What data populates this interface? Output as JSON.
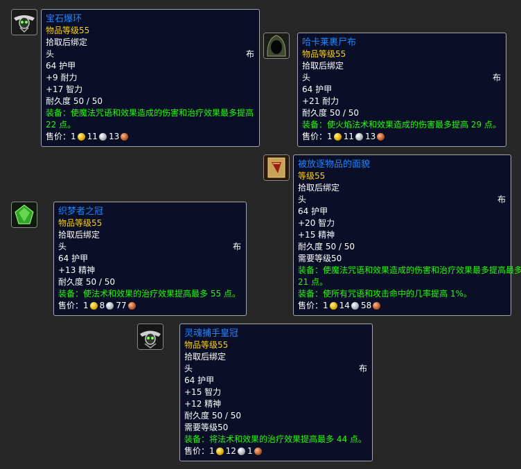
{
  "labels": {
    "bind": "拾取后绑定",
    "slot": "头",
    "type": "布",
    "equip_prefix": "装备：",
    "price_prefix": "售价："
  },
  "items": [
    {
      "name": "宝石爆环",
      "level": "物品等级55",
      "armor": "64 护甲",
      "stats": [
        "+9 耐力",
        "+17 智力"
      ],
      "durability": "耐久度 50 / 50",
      "equip": [
        "使魔法咒语和效果造成的伤害和治疗效果最多提高",
        "22 点。"
      ],
      "price": {
        "gold": "1",
        "silver": "11",
        "copper": "13"
      },
      "icon": "skull-circlet-icon"
    },
    {
      "name": "哈卡莱裹尸布",
      "level": "物品等级55",
      "armor": "64 护甲",
      "stats": [
        "+21 耐力"
      ],
      "durability": "耐久度 50 / 50",
      "equip": [
        "使火焰法术和效果造成的伤害最多提高 29 点。"
      ],
      "price": {
        "gold": "1",
        "silver": "11",
        "copper": "13"
      },
      "icon": "hood-icon"
    },
    {
      "name": "被放逐物品的面貌",
      "level": "等级55",
      "armor": "64 护甲",
      "stats": [
        "+20 智力",
        "+15 精神"
      ],
      "durability": "耐久度 50 / 50",
      "required": "需要等级50",
      "equip": [
        "使魔法咒语和效果造成的伤害和治疗效果最多提高最多",
        "21 点。"
      ],
      "equip2": [
        "使所有咒语和攻击命中的几率提高 1%。"
      ],
      "price": {
        "gold": "1",
        "silver": "14",
        "copper": "58"
      },
      "icon": "scroll-mask-icon"
    },
    {
      "name": "织梦者之冠",
      "level": "物品等级55",
      "armor": "64 护甲",
      "stats": [
        "+13 精神"
      ],
      "durability": "耐久度 50 / 50",
      "equip": [
        "使法术和效果的治疗效果提高最多 55 点。"
      ],
      "price": {
        "gold": "1",
        "silver": "8",
        "copper": "77"
      },
      "icon": "green-gem-icon"
    },
    {
      "name": "灵魂捕手皇冠",
      "level": "物品等级55",
      "armor": "64 护甲",
      "stats": [
        "+15 智力",
        "+12 精神"
      ],
      "durability": "耐久度 50 / 50",
      "required": "需要等级50",
      "equip": [
        "将法术和效果的治疗效果提高最多 44 点。"
      ],
      "price": {
        "gold": "1",
        "silver": "12",
        "copper": "1"
      },
      "icon": "crown-icon"
    }
  ]
}
